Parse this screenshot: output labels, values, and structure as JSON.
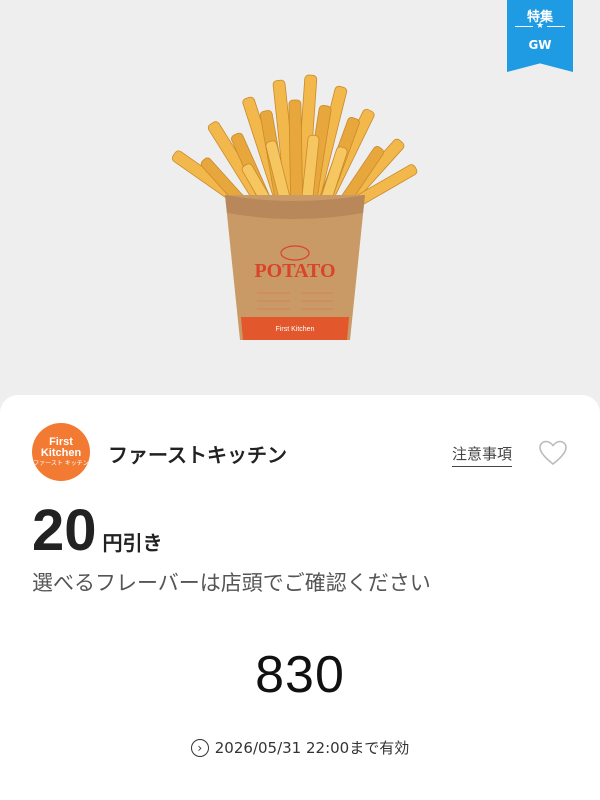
{
  "badge": {
    "top": "特集",
    "star": "★",
    "bottom": "GW",
    "color": "#1f9be4"
  },
  "product": {
    "bag_text": "POTATO",
    "bag_brand": "First Kitchen"
  },
  "shop": {
    "logo_line1": "First",
    "logo_line2": "Kitchen",
    "logo_line3": "ファースト キッチン",
    "name": "ファーストキッチン",
    "brand_color": "#f37a32"
  },
  "notice_link": "注意事項",
  "coupon": {
    "amount": "20",
    "unit": "円引き",
    "description": "選べるフレーバーは店頭でご確認ください",
    "code": "830",
    "expiry": "2026/05/31 22:00まで有効"
  },
  "icons": {
    "favorite": "heart-outline-icon",
    "expiry": "chevron-right-circle-icon"
  }
}
